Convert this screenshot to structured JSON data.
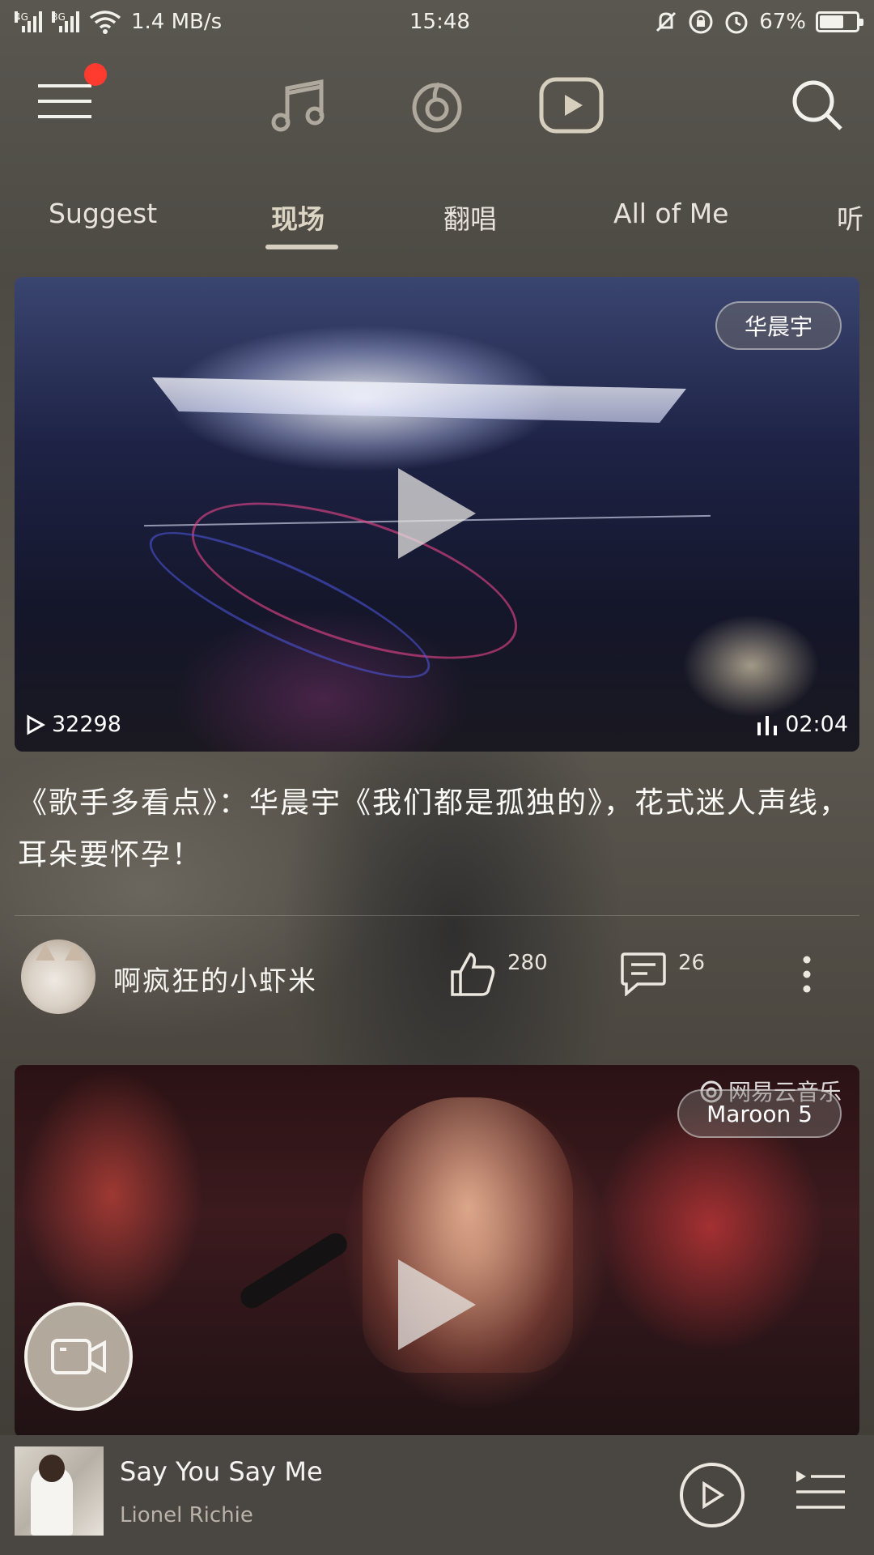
{
  "status_bar": {
    "net_speed": "1.4 MB/s",
    "time": "15:48",
    "battery": "67%",
    "battery_level": 0.67,
    "sim1": "4G",
    "sim2": "3G"
  },
  "tabs": [
    "Suggest",
    "现场",
    "翻唱",
    "All of Me",
    "听"
  ],
  "active_tab": "现场",
  "video1": {
    "tag": "华晨宇",
    "play_count": "32298",
    "duration": "02:04",
    "title": "《歌手多看点》：华晨宇《我们都是孤独的》，花式迷人声线，耳朵要怀孕！"
  },
  "author": {
    "name": "啊疯狂的小虾米",
    "likes": "280",
    "comments": "26"
  },
  "video2": {
    "tag": "Maroon 5",
    "watermark": "网易云音乐"
  },
  "player": {
    "title": "Say You Say Me",
    "artist": "Lionel Richie"
  },
  "icons": {
    "menu": "hamburger-icon",
    "music": "music-note-icon",
    "radio": "netease-radio-icon",
    "video": "video-play-icon",
    "search": "search-icon"
  }
}
